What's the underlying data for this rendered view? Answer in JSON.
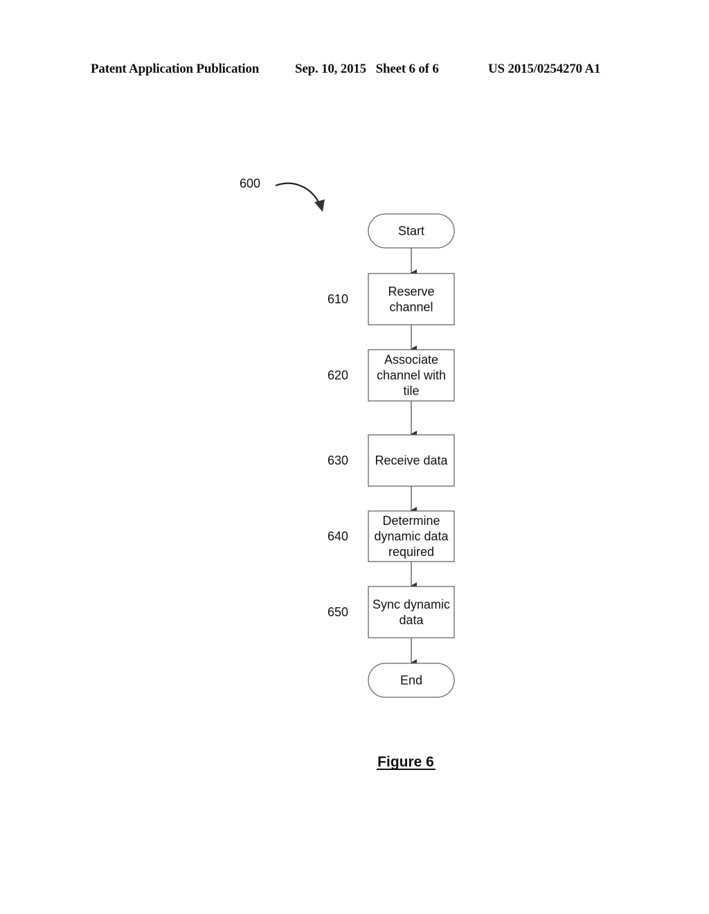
{
  "header": {
    "publication": "Patent Application Publication",
    "date_sheet": "Sep. 10, 2015   Sheet 6 of 6",
    "number": "US 2015/0254270 A1"
  },
  "diagram": {
    "ref_number": "600",
    "figure_title": "Figure 6",
    "nodes": [
      {
        "id": "start",
        "type": "terminal",
        "lines": [
          "Start"
        ],
        "ref": ""
      },
      {
        "id": "n610",
        "type": "process",
        "lines": [
          "Reserve",
          "channel"
        ],
        "ref": "610"
      },
      {
        "id": "n620",
        "type": "process",
        "lines": [
          "Associate",
          "channel with",
          "tile"
        ],
        "ref": "620"
      },
      {
        "id": "n630",
        "type": "process",
        "lines": [
          "Receive data"
        ],
        "ref": "630"
      },
      {
        "id": "n640",
        "type": "process",
        "lines": [
          "Determine",
          "dynamic data",
          "required"
        ],
        "ref": "640"
      },
      {
        "id": "n650",
        "type": "process",
        "lines": [
          "Sync dynamic",
          "data"
        ],
        "ref": "650"
      },
      {
        "id": "end",
        "type": "terminal",
        "lines": [
          "End"
        ],
        "ref": ""
      }
    ],
    "edges": [
      [
        "start",
        "n610"
      ],
      [
        "n610",
        "n620"
      ],
      [
        "n620",
        "n630"
      ],
      [
        "n630",
        "n640"
      ],
      [
        "n640",
        "n650"
      ],
      [
        "n650",
        "end"
      ]
    ]
  }
}
